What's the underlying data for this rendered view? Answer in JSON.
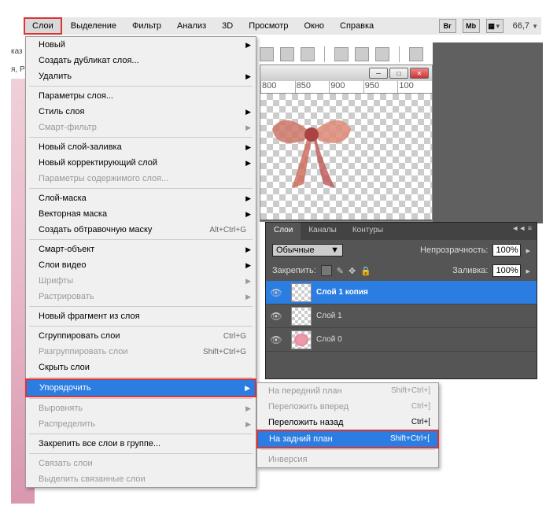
{
  "menubar": {
    "items": [
      "Слои",
      "Выделение",
      "Фильтр",
      "Анализ",
      "3D",
      "Просмотр",
      "Окно",
      "Справка"
    ],
    "active_index": 0,
    "buttons": [
      "Br",
      "Mb"
    ],
    "zoom": "66,7"
  },
  "dropdown": [
    {
      "type": "item",
      "label": "Новый",
      "submenu": true
    },
    {
      "type": "item",
      "label": "Создать дубликат слоя..."
    },
    {
      "type": "item",
      "label": "Удалить",
      "submenu": true
    },
    {
      "type": "sep"
    },
    {
      "type": "item",
      "label": "Параметры слоя..."
    },
    {
      "type": "item",
      "label": "Стиль слоя",
      "submenu": true
    },
    {
      "type": "item",
      "label": "Смарт-фильтр",
      "submenu": true,
      "disabled": true
    },
    {
      "type": "sep"
    },
    {
      "type": "item",
      "label": "Новый слой-заливка",
      "submenu": true
    },
    {
      "type": "item",
      "label": "Новый корректирующий слой",
      "submenu": true
    },
    {
      "type": "item",
      "label": "Параметры содержимого слоя...",
      "disabled": true
    },
    {
      "type": "sep"
    },
    {
      "type": "item",
      "label": "Слой-маска",
      "submenu": true
    },
    {
      "type": "item",
      "label": "Векторная маска",
      "submenu": true
    },
    {
      "type": "item",
      "label": "Создать обтравочную маску",
      "shortcut": "Alt+Ctrl+G"
    },
    {
      "type": "sep"
    },
    {
      "type": "item",
      "label": "Смарт-объект",
      "submenu": true
    },
    {
      "type": "item",
      "label": "Слои видео",
      "submenu": true
    },
    {
      "type": "item",
      "label": "Шрифты",
      "submenu": true,
      "disabled": true
    },
    {
      "type": "item",
      "label": "Растрировать",
      "submenu": true,
      "disabled": true
    },
    {
      "type": "sep"
    },
    {
      "type": "item",
      "label": "Новый фрагмент из слоя"
    },
    {
      "type": "sep"
    },
    {
      "type": "item",
      "label": "Сгруппировать слои",
      "shortcut": "Ctrl+G"
    },
    {
      "type": "item",
      "label": "Разгруппировать слои",
      "shortcut": "Shift+Ctrl+G",
      "disabled": true
    },
    {
      "type": "item",
      "label": "Скрыть слои"
    },
    {
      "type": "sep"
    },
    {
      "type": "item",
      "label": "Упорядочить",
      "submenu": true,
      "highlight": true,
      "redbox": true
    },
    {
      "type": "sep"
    },
    {
      "type": "item",
      "label": "Выровнять",
      "submenu": true,
      "disabled": true
    },
    {
      "type": "item",
      "label": "Распределить",
      "submenu": true,
      "disabled": true
    },
    {
      "type": "sep"
    },
    {
      "type": "item",
      "label": "Закрепить все слои в группе..."
    },
    {
      "type": "sep"
    },
    {
      "type": "item",
      "label": "Связать слои",
      "disabled": true
    },
    {
      "type": "item",
      "label": "Выделить связанные слои",
      "disabled": true
    }
  ],
  "submenu": [
    {
      "type": "item",
      "label": "На передний план",
      "shortcut": "Shift+Ctrl+]",
      "disabled": true
    },
    {
      "type": "item",
      "label": "Переложить вперед",
      "shortcut": "Ctrl+]",
      "disabled": true
    },
    {
      "type": "item",
      "label": "Переложить назад",
      "shortcut": "Ctrl+["
    },
    {
      "type": "item",
      "label": "На задний план",
      "shortcut": "Shift+Ctrl+[",
      "highlight": true,
      "redbox": true
    },
    {
      "type": "sep"
    },
    {
      "type": "item",
      "label": "Инверсия",
      "disabled": true
    }
  ],
  "ruler": [
    "800",
    "850",
    "900",
    "950",
    "100"
  ],
  "panel": {
    "tabs": [
      "Слои",
      "Каналы",
      "Контуры"
    ],
    "blend_label": "Обычные",
    "opacity_label": "Непрозрачность:",
    "opacity_val": "100%",
    "lock_label": "Закрепить:",
    "fill_label": "Заливка:",
    "fill_val": "100%",
    "layers": [
      {
        "name": "Слой 1 копия",
        "selected": true
      },
      {
        "name": "Слой 1"
      },
      {
        "name": "Слой 0"
      }
    ]
  },
  "left": {
    "l1": "каз",
    "l2": "я, Р"
  }
}
